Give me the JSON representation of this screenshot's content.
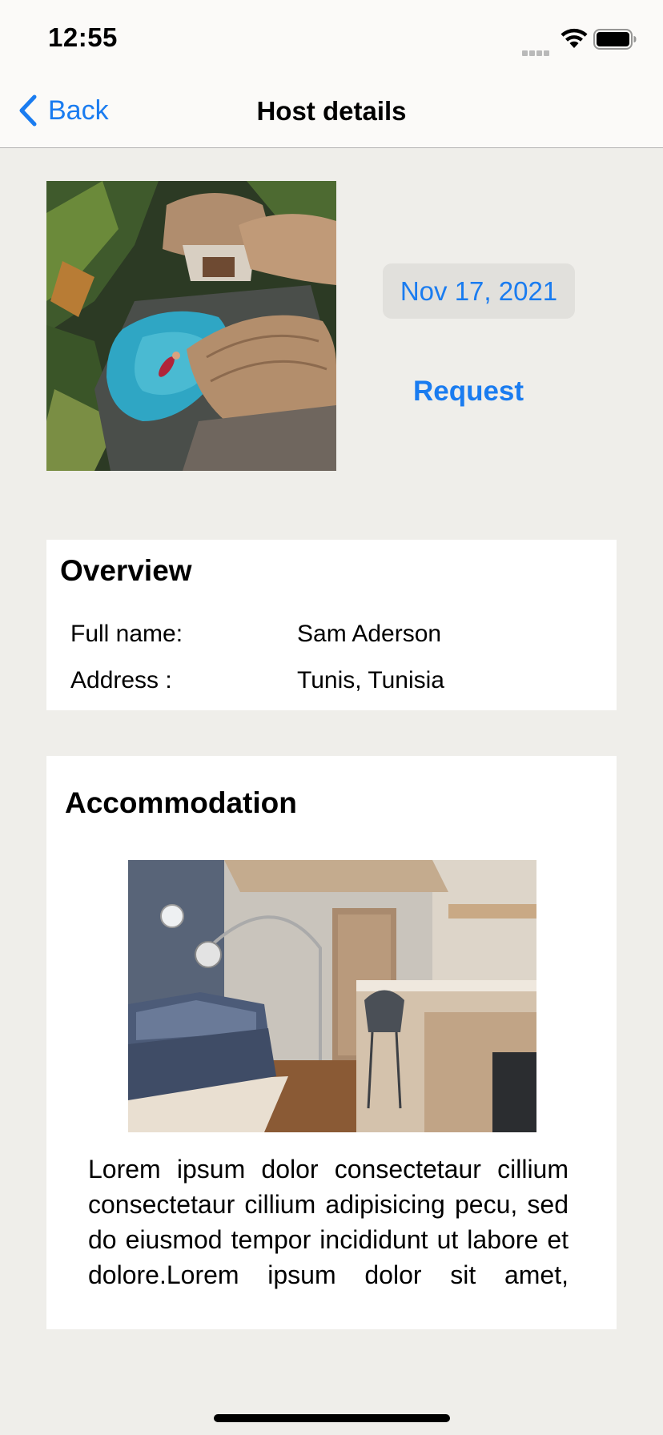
{
  "status_bar": {
    "time": "12:55"
  },
  "nav": {
    "back_label": "Back",
    "title": "Host details"
  },
  "header": {
    "date": "Nov 17, 2021",
    "request_label": "Request"
  },
  "overview": {
    "title": "Overview",
    "rows": [
      {
        "label": "Full name:",
        "value": "Sam Aderson"
      },
      {
        "label": "Address :",
        "value": "Tunis, Tunisia"
      }
    ]
  },
  "accommodation": {
    "title": "Accommodation",
    "description": "Lorem ipsum dolor consectetaur cillium consectetaur cillium adipisicing pecu, sed do eiusmod tempor incididunt ut labore et dolore.Lorem ipsum dolor sit amet, consectetaur cillium adipisicing"
  },
  "colors": {
    "accent": "#1a7cf0",
    "background": "#efeeea",
    "card": "#ffffff",
    "date_chip": "#e1e0dc"
  },
  "icons": {
    "back": "chevron-left-icon",
    "signal": "cellular-signal-icon",
    "wifi": "wifi-icon",
    "battery": "battery-icon"
  }
}
